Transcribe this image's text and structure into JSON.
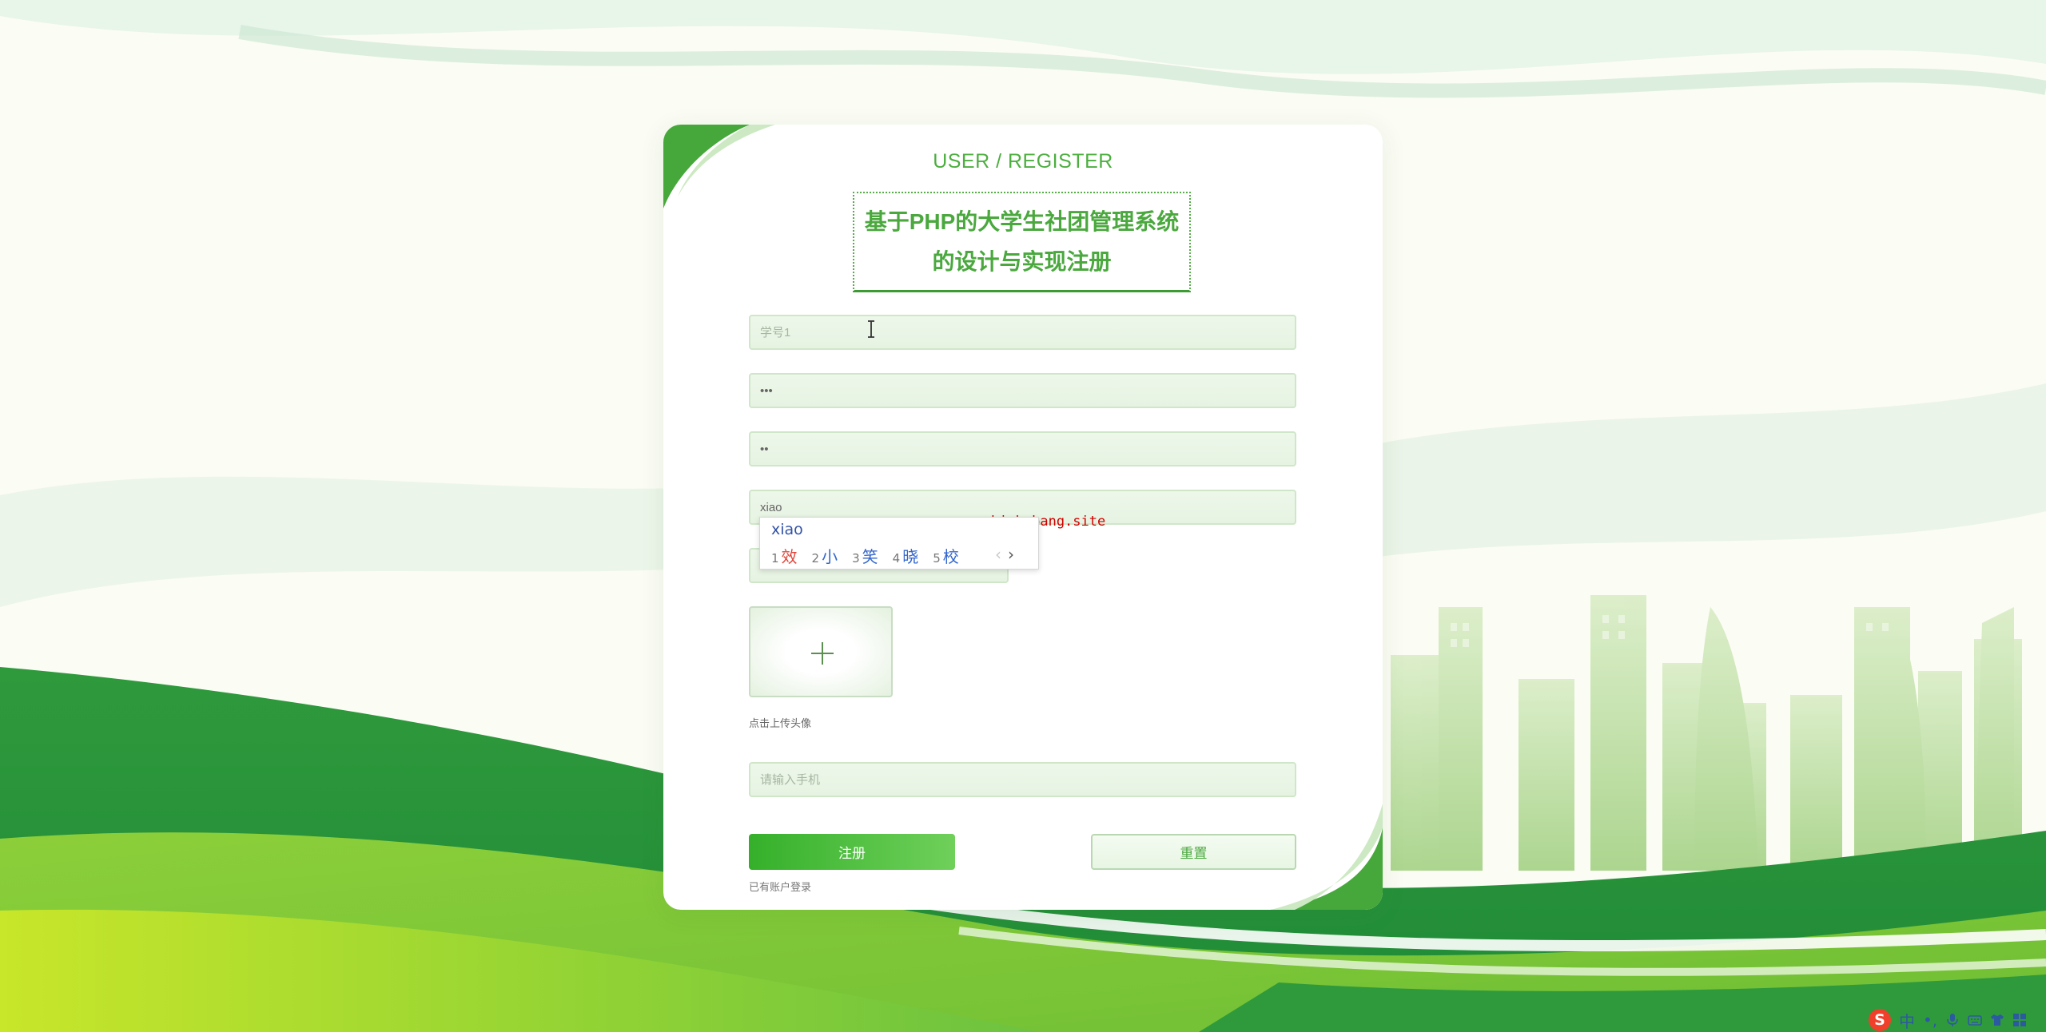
{
  "header": {
    "title": "USER / REGISTER",
    "system_title": "基于PHP的大学生社团管理系统的设计与实现注册"
  },
  "form": {
    "student_id_placeholder": "学号1",
    "password_value": "•••",
    "confirm_password_value": "••",
    "name_value": "xiao",
    "short_field_value": "",
    "avatar_hint": "点击上传头像",
    "phone_placeholder": "请输入手机"
  },
  "ime": {
    "input": "xiao",
    "candidates": [
      {
        "num": "1",
        "text": "效"
      },
      {
        "num": "2",
        "text": "小"
      },
      {
        "num": "3",
        "text": "笑"
      },
      {
        "num": "4",
        "text": "晓"
      },
      {
        "num": "5",
        "text": "校"
      }
    ],
    "prev": "‹",
    "next": "›"
  },
  "watermark": "www.bishebang.site",
  "buttons": {
    "register": "注册",
    "reset": "重置",
    "login_link": "已有账户登录"
  },
  "taskbar": {
    "logo": "S",
    "lang": "中",
    "punct": "•,",
    "icons": [
      "microphone-icon",
      "keyboard-icon",
      "skin-icon",
      "toolbox-icon"
    ]
  },
  "colors": {
    "accent": "#4cae3f",
    "button": "#35b02b",
    "watermark": "#d10000"
  }
}
